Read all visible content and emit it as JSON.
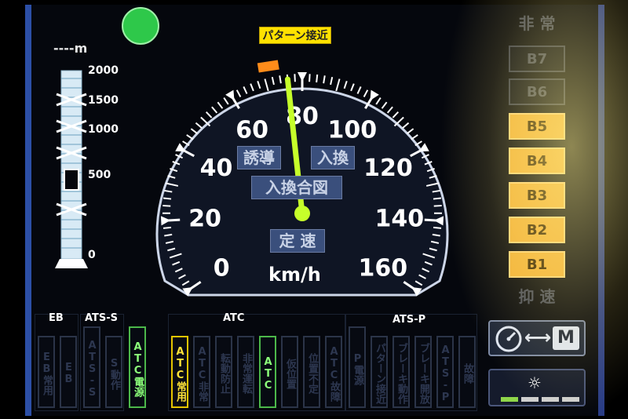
{
  "distance": {
    "readout": "----m",
    "scale_labels": [
      "2000",
      "1500",
      "1000",
      "500",
      "0"
    ]
  },
  "pattern_badge": "パターン接近",
  "speedometer": {
    "ticks": [
      "0",
      "20",
      "40",
      "60",
      "80",
      "100",
      "120",
      "140",
      "160"
    ],
    "unit": "km/h",
    "needle_speed": 76,
    "max_speed": 160,
    "tags": {
      "yudo": "誘導",
      "irekae": "入換",
      "irekae_aizu": "入換合図",
      "teisoku": "定 速"
    },
    "colors": {
      "needle": "#c6ff2a",
      "dial": "#0f1524",
      "marker": "#ff8c1a"
    }
  },
  "brakes": {
    "hijo": "非 常",
    "items": [
      {
        "label": "B7",
        "on": false
      },
      {
        "label": "B6",
        "on": false
      },
      {
        "label": "B5",
        "on": true
      },
      {
        "label": "B4",
        "on": true
      },
      {
        "label": "B3",
        "on": true
      },
      {
        "label": "B2",
        "on": true
      },
      {
        "label": "B1",
        "on": true
      }
    ],
    "yokusoku": "抑 速"
  },
  "sections": {
    "eb": "EB",
    "ats_s": "ATS-S",
    "atc": "ATC",
    "ats_p": "ATS-P"
  },
  "lamps": {
    "eb": [
      "EB常用",
      "EB"
    ],
    "ats_s": [
      "ATS-S",
      "S動作"
    ],
    "power": "ATC電源",
    "atc": [
      "ATC常用",
      "ATC非常",
      "転動防止",
      "非常運転",
      "ATC",
      "仮位置",
      "位置不定",
      "ATC故障"
    ],
    "ats_p": [
      "P電源",
      "パターン接近",
      "ブレーキ動作",
      "ブレーキ開放",
      "ATS-P",
      "故障"
    ]
  },
  "buttons": {
    "mode": {
      "arrow": "⟷",
      "letter": "M",
      "icons": [
        "gauge-icon",
        "m-icon"
      ]
    },
    "brightness": {
      "icon": "sun-icon",
      "symbol": "☼"
    }
  }
}
